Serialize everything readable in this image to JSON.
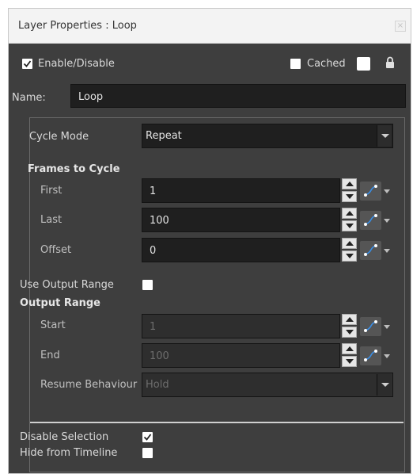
{
  "window": {
    "title": "Layer Properties : Loop",
    "close_glyph": "×"
  },
  "top": {
    "enable_label": "Enable/Disable",
    "enable_checked": true,
    "cached_label": "Cached",
    "cached_checked": false
  },
  "name_field": {
    "label": "Name:",
    "value": "Loop"
  },
  "cycle_mode": {
    "label": "Cycle Mode",
    "value": "Repeat"
  },
  "frames_to_cycle": {
    "heading": "Frames to Cycle",
    "first_label": "First",
    "first_value": "1",
    "last_label": "Last",
    "last_value": "100",
    "offset_label": "Offset",
    "offset_value": "0"
  },
  "use_output_range": {
    "label": "Use Output Range",
    "checked": false
  },
  "output_range": {
    "heading": "Output Range",
    "start_label": "Start",
    "start_value": "1",
    "end_label": "End",
    "end_value": "100",
    "resume_label": "Resume Behaviour",
    "resume_value": "Hold"
  },
  "disable_selection": {
    "label": "Disable Selection",
    "checked": true
  },
  "hide_from_timeline": {
    "label": "Hide from Timeline",
    "checked": false
  },
  "colors": {
    "panel_bg": "#3e3e3e",
    "field_bg": "#1f1f1f",
    "accent_link": "#3a8ee6"
  }
}
